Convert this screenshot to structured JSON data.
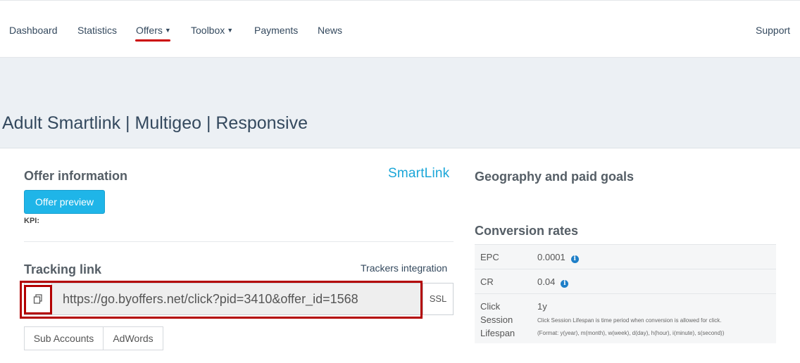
{
  "nav": {
    "items": [
      {
        "label": "Dashboard"
      },
      {
        "label": "Statistics"
      },
      {
        "label": "Offers"
      },
      {
        "label": "Toolbox"
      },
      {
        "label": "Payments"
      },
      {
        "label": "News"
      }
    ],
    "support": "Support",
    "active": "Offers",
    "accent_color": "#cc0000"
  },
  "page": {
    "title": "Adult Smartlink | Multigeo | Responsive"
  },
  "offer_info": {
    "title": "Offer information",
    "brand_logo": "SmartLink",
    "preview_button": "Offer preview",
    "kpi_label": "KPI:"
  },
  "tracking": {
    "title": "Tracking link",
    "trackers_link": "Trackers integration",
    "url": "https://go.byoffers.net/click?pid=3410&offer_id=1568",
    "ssl_label": "SSL",
    "copy_icon": "copy-icon",
    "tabs": [
      "Sub Accounts",
      "AdWords"
    ]
  },
  "geography": {
    "title": "Geography and paid goals"
  },
  "conversion": {
    "title": "Conversion rates",
    "rows": [
      {
        "label": "EPC",
        "value": "0.0001"
      },
      {
        "label": "CR",
        "value": "0.04"
      },
      {
        "label_lines": [
          "Click",
          "Session",
          "Lifespan"
        ],
        "value": "1y",
        "desc1": "Click Session Lifespan is time period when conversion is allowed for click.",
        "desc2": "(Format: y(year), m(month), w(week), d(day), h(hour), i(minute), s(second))"
      }
    ]
  },
  "colors": {
    "primary_button": "#1fb5e8",
    "header_band": "#ecf0f4",
    "highlight": "#b30000",
    "info_icon": "#1e7fc8"
  }
}
